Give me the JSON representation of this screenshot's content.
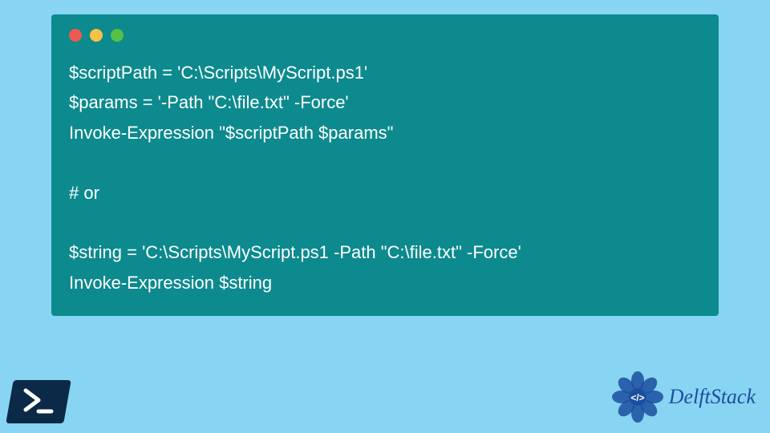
{
  "code": {
    "line1": "$scriptPath = 'C:\\Scripts\\MyScript.ps1'",
    "line2": "$params = '-Path \"C:\\file.txt\" -Force'",
    "line3": "Invoke-Expression \"$scriptPath $params\"",
    "line4": "",
    "line5": "# or",
    "line6": "",
    "line7": "$string = 'C:\\Scripts\\MyScript.ps1 -Path \"C:\\file.txt\" -Force'",
    "line8": "Invoke-Expression $string"
  },
  "icons": {
    "powershell_prompt": ">_"
  },
  "logo": {
    "text": "DelftStack"
  },
  "colors": {
    "background": "#87d5f2",
    "window": "#0d8a8e",
    "text": "#ffffff",
    "brand": "#1c4ea0"
  }
}
